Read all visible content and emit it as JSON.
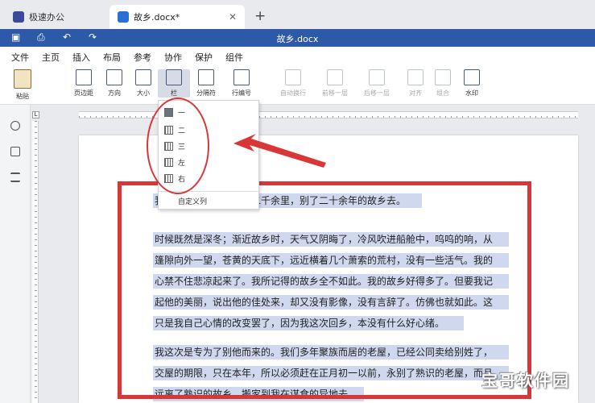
{
  "tabs": [
    {
      "label": "极速办公",
      "icon": "rocket-icon"
    },
    {
      "label": "故乡.docx*",
      "icon": "document-icon"
    }
  ],
  "new_tab_glyph": "+",
  "close_glyph": "✕",
  "window_title": "故乡.docx",
  "menu": [
    "文件",
    "主页",
    "插入",
    "布局",
    "参考",
    "协作",
    "保护",
    "组件"
  ],
  "active_menu": "布局",
  "ribbon": {
    "paste": "粘贴",
    "margins": "页边距",
    "orientation": "方向",
    "size": "大小",
    "columns": "栏",
    "breaks": "分隔符",
    "line_numbers": "行编号",
    "wrap": "自动换行",
    "bring_forward": "前移一层",
    "send_backward": "后移一层",
    "align": "对齐",
    "group": "组合",
    "watermark": "水印"
  },
  "columns_menu": {
    "items": [
      "一",
      "二",
      "三",
      "左",
      "右"
    ],
    "custom": "自定义列"
  },
  "document_lines": [
    "我冒了严寒，回到相隔二千余里，别了二十余年的故乡去。",
    "时候既然是深冬；渐近故乡时，天气又阴晦了，冷风吹进船舱中，呜呜的响，从",
    "篷隙向外一望，苍黄的天底下，远近横着几个萧索的荒村，没有一些活气。我的",
    "心禁不住悲凉起来了。我所记得的故乡全不如此。我的故乡好得多了。但要我记",
    "起他的美丽，说出他的佳处来，却又没有影像，没有言辞了。仿佛也就如此。这",
    "只是我自己心情的改变罢了，因为我这次回乡，本没有什么好心绪。",
    "我这次是专为了别他而来的。我们多年聚族而居的老屋，已经公同卖给别姓了，",
    "交屋的期限，只在本年，所以必须赶在正月初一以前，永别了熟识的老屋，而且",
    "远离了熟识的故乡，搬家到我在谋食的异地去。"
  ],
  "watermark_text": "宝哥软件园",
  "colors": {
    "accent": "#2c5aa8",
    "annotation": "#d93737",
    "selection": "#cfd8ee"
  }
}
